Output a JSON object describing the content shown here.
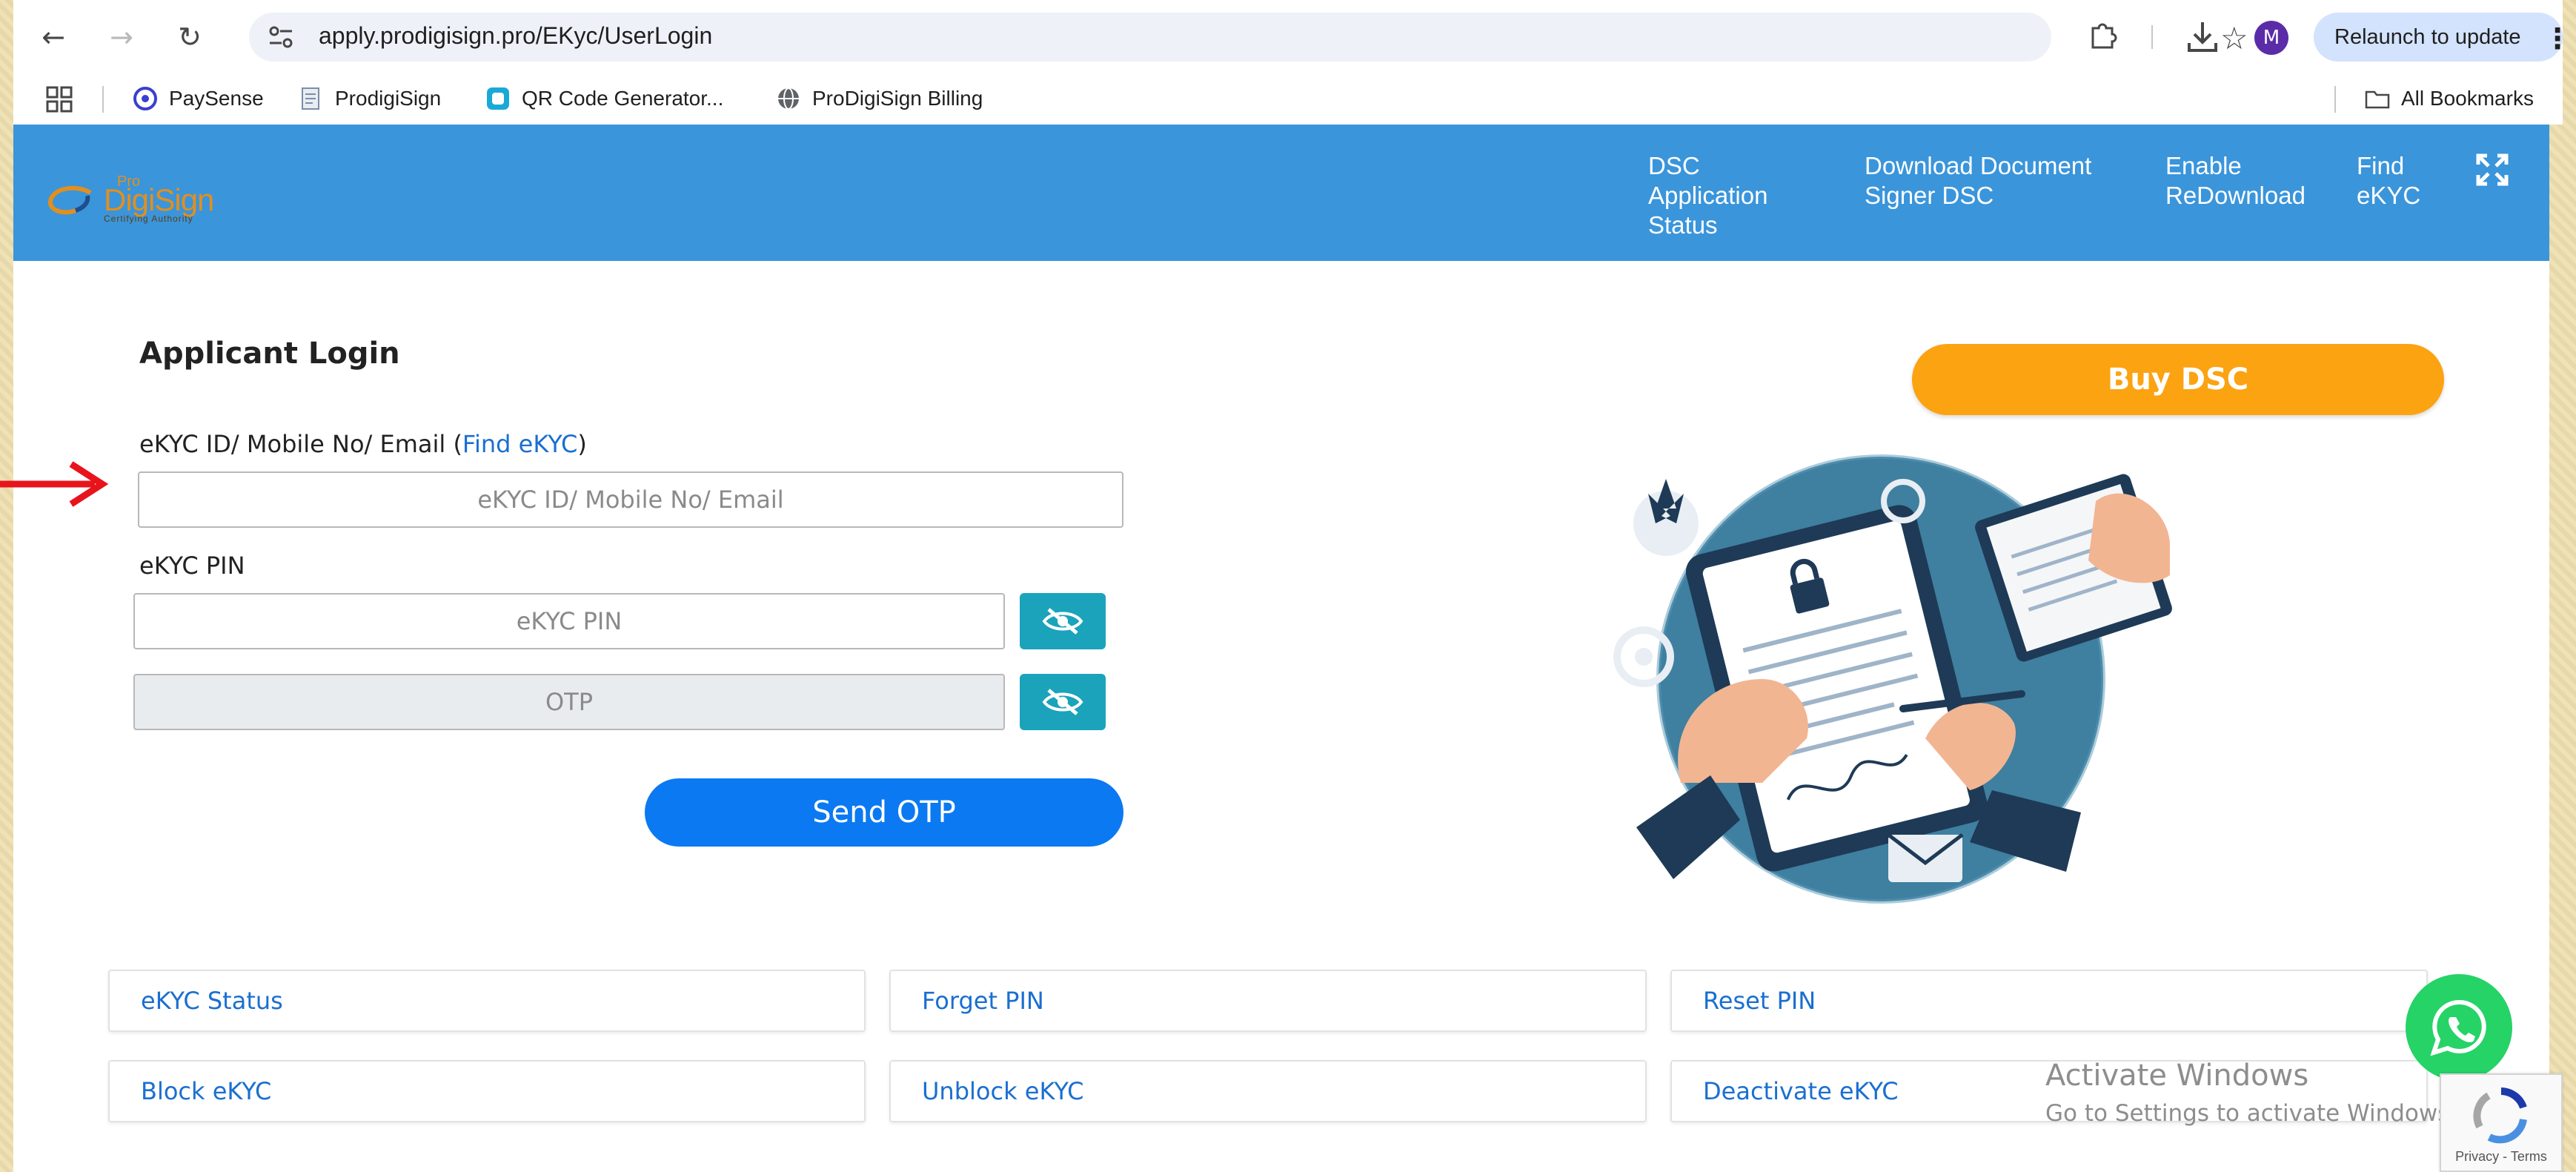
{
  "browser": {
    "url": "apply.prodigisign.pro/EKyc/UserLogin",
    "profile_initial": "M",
    "relaunch_label": "Relaunch to update"
  },
  "bookmarks": {
    "items": [
      {
        "label": "PaySense"
      },
      {
        "label": "ProdigiSign"
      },
      {
        "label": "QR Code Generator..."
      },
      {
        "label": "ProDigiSign Billing"
      }
    ],
    "all_bookmarks": "All Bookmarks"
  },
  "header": {
    "logo_small": "Pro",
    "logo_main": "DigiSign",
    "logo_sub": "Certifying Authority",
    "nav": {
      "dsc_status": [
        "DSC",
        "Application",
        "Status"
      ],
      "download_doc_signer": [
        "Download Document",
        "Signer DSC"
      ],
      "enable_redownload": [
        "Enable",
        "ReDownload"
      ],
      "find_ekyc": [
        "Find",
        "eKYC"
      ]
    }
  },
  "login": {
    "title": "Applicant Login",
    "id_label_prefix": "eKYC ID/ Mobile No/ Email (",
    "id_label_link": "Find eKYC",
    "id_label_suffix": ")",
    "id_placeholder": "eKYC ID/ Mobile No/ Email",
    "pin_label": "eKYC PIN",
    "pin_placeholder": "eKYC PIN",
    "otp_placeholder": "OTP",
    "send_otp": "Send OTP"
  },
  "buy_dsc": "Buy DSC",
  "links": [
    {
      "label": "eKYC Status"
    },
    {
      "label": "Forget PIN"
    },
    {
      "label": "Reset PIN"
    },
    {
      "label": "Block eKYC"
    },
    {
      "label": "Unblock eKYC"
    },
    {
      "label": "Deactivate eKYC"
    }
  ],
  "watermark": {
    "title": "Activate Windows",
    "subtitle": "Go to Settings to activate Windows."
  },
  "recaptcha": {
    "privacy": "Privacy",
    "separator": " - ",
    "terms": "Terms"
  },
  "colors": {
    "header_bg": "#3a95db",
    "primary_button": "#0b79f2",
    "buy_button": "#fca311",
    "eye_button": "#1ba3bb",
    "link": "#1a6fd0",
    "whatsapp": "#25d366"
  }
}
